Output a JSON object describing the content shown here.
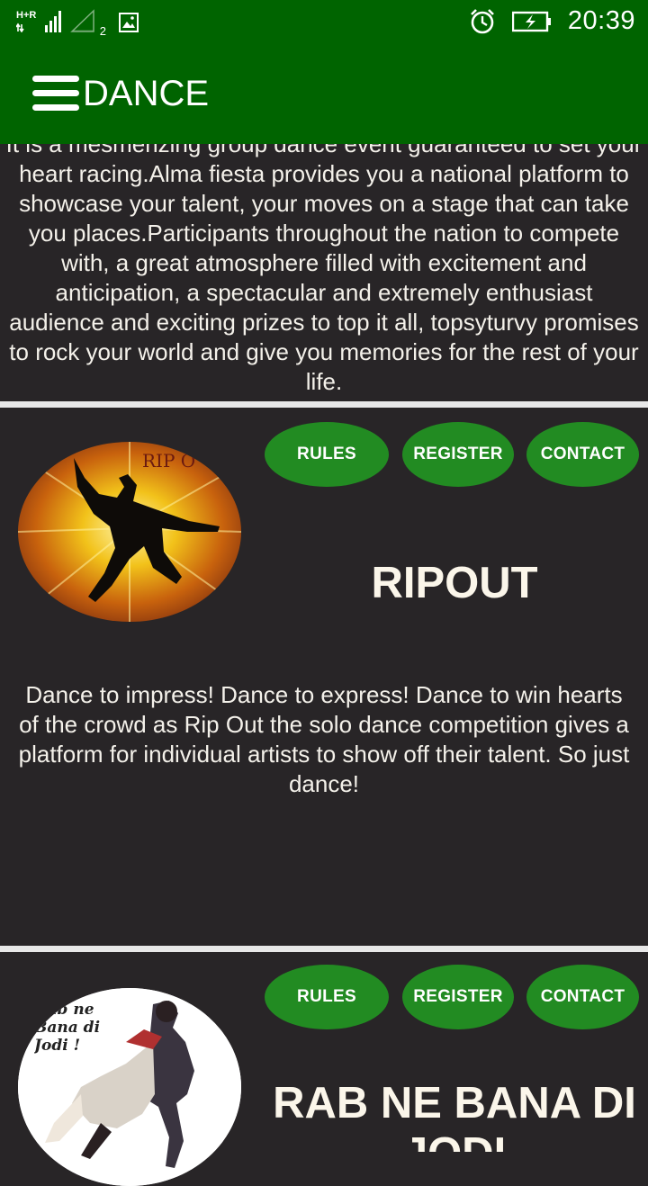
{
  "status_bar": {
    "network_label": "H+R",
    "sim_slot": "2",
    "time": "20:39"
  },
  "app_bar": {
    "title": "DANCE"
  },
  "intro": {
    "text": "It is a mesmerizing group dance event guaranteed to set your heart racing.Alma fiesta provides you a national platform to showcase your talent, your moves on a stage that can take you places.Participants throughout the nation to compete with, a great atmosphere filled with excitement and anticipation, a spectacular and extremely enthusiast audience and exciting prizes to top it all, topsyturvy promises to rock your world and give you memories for the rest of your life."
  },
  "events": [
    {
      "title": "RIPOUT",
      "logo_text": "RIP O",
      "rules_label": "RULES",
      "register_label": "REGISTER",
      "contact_label": "CONTACT",
      "description": "Dance to impress! Dance to express! Dance to win hearts of the crowd as Rip Out the solo dance competition gives a platform for individual artists to show off their talent. So just dance!"
    },
    {
      "title": "RAB NE BANA DI JODI",
      "logo_text": "Rab ne Bana di Jodi !",
      "rules_label": "RULES",
      "register_label": "REGISTER",
      "contact_label": "CONTACT"
    }
  ],
  "colors": {
    "app_bar": "#006400",
    "button": "#228b22",
    "background": "#282527",
    "divider": "#e8e8e8"
  }
}
